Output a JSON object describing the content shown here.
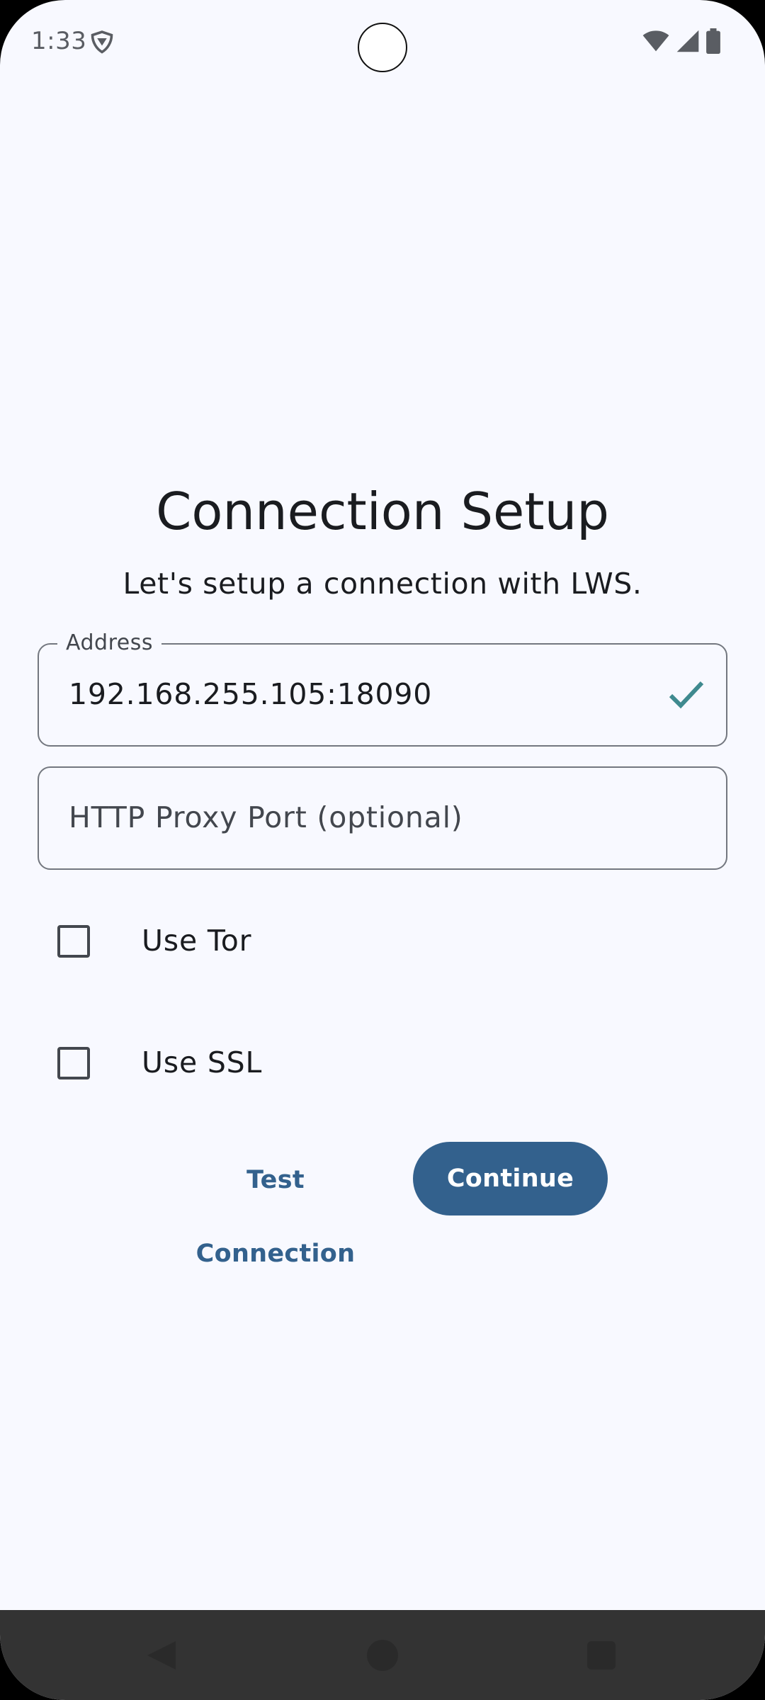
{
  "status_bar": {
    "time": "1:33",
    "app_icon": "vpn-shield-icon",
    "icons": [
      "wifi-icon",
      "signal-icon",
      "battery-icon"
    ]
  },
  "header": {
    "title": "Connection Setup",
    "subtitle": "Let's setup a connection with LWS."
  },
  "form": {
    "address": {
      "label": "Address",
      "value": "192.168.255.105:18090",
      "valid_icon": "check-icon"
    },
    "proxy_port": {
      "placeholder": "HTTP Proxy Port (optional)",
      "value": ""
    },
    "use_tor": {
      "label": "Use Tor",
      "checked": false
    },
    "use_ssl": {
      "label": "Use SSL",
      "checked": false
    }
  },
  "actions": {
    "test_label": "Test Connection",
    "continue_label": "Continue"
  },
  "nav_bar": {
    "icons": [
      "back-icon",
      "home-icon",
      "recents-icon"
    ]
  },
  "colors": {
    "background": "#f8f9ff",
    "primary": "#33618d",
    "outline": "#73777f",
    "valid_check": "#3f8a8f",
    "on_surface": "#1a1c20",
    "nav_bar": "#333333"
  }
}
